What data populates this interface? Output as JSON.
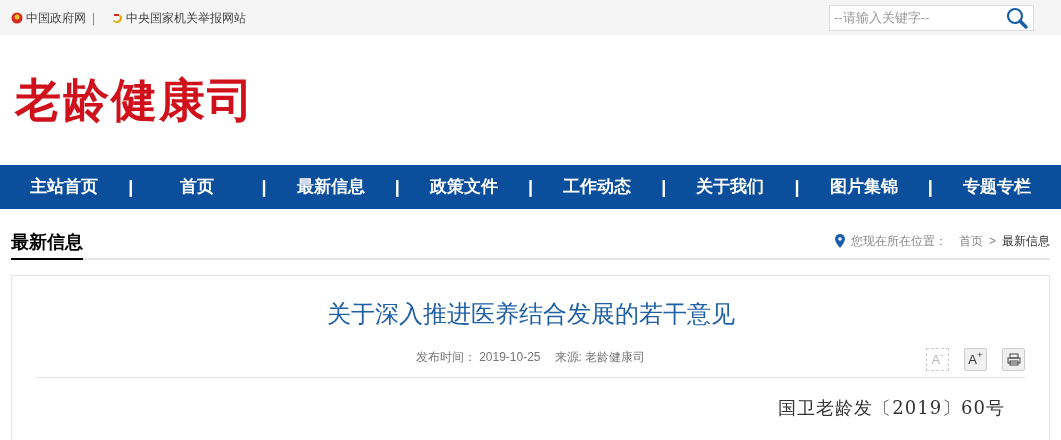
{
  "top_links": [
    {
      "label": "中国政府网",
      "separator": "|"
    },
    {
      "label": "中央国家机关举报网站"
    }
  ],
  "search": {
    "placeholder": "--请输入关键字--"
  },
  "logo": "老龄健康司",
  "nav": [
    {
      "label": "主站首页"
    },
    {
      "label": "首页"
    },
    {
      "label": "最新信息"
    },
    {
      "label": "政策文件"
    },
    {
      "label": "工作动态"
    },
    {
      "label": "关于我们"
    },
    {
      "label": "图片集锦"
    },
    {
      "label": "专题专栏"
    }
  ],
  "nav_separator": "|",
  "section_title": "最新信息",
  "breadcrumb": {
    "prefix": "您现在所在位置：",
    "items": [
      "首页",
      "最新信息"
    ],
    "separator": ">"
  },
  "article": {
    "title": "关于深入推进医养结合发展的若干意见",
    "date_label": "发布时间：",
    "date": "2019-10-25",
    "source_label": "来源:",
    "source": "老龄健康司",
    "tools": [
      {
        "kind": "text",
        "label": "A$^{-}$",
        "disabled": true
      },
      {
        "kind": "text",
        "label": "A$^{+}$",
        "disabled": false
      },
      {
        "kind": "print",
        "disabled": false
      }
    ],
    "doc_number": "国卫老龄发〔2019〕60号"
  }
}
